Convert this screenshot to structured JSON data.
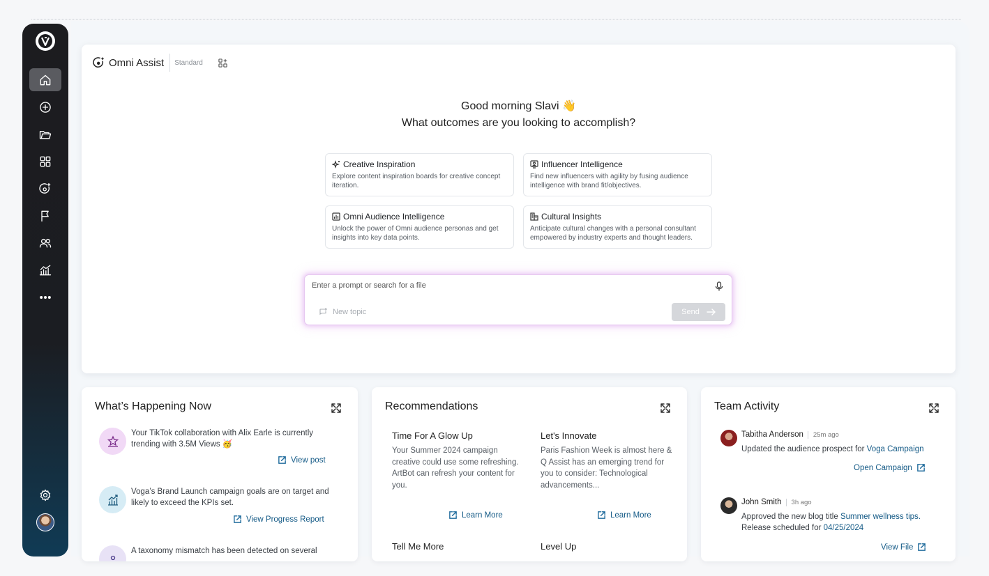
{
  "sidebar": {
    "items": [
      {
        "name": "home-icon",
        "active": true
      },
      {
        "name": "add-circle-icon"
      },
      {
        "name": "folder-icon"
      },
      {
        "name": "apps-grid-icon"
      },
      {
        "name": "assist-icon"
      },
      {
        "name": "flag-icon"
      },
      {
        "name": "users-icon"
      },
      {
        "name": "analytics-icon"
      },
      {
        "name": "more-icon"
      }
    ],
    "bottom": [
      "gear-icon",
      "avatar"
    ]
  },
  "assist": {
    "brand": "Omni Assist",
    "tier": "Standard",
    "greeting": "Good morning Slavi 👋",
    "question": "What outcomes are you looking to accomplish?",
    "options": [
      {
        "icon": "sparkle-icon",
        "title": "Creative Inspiration",
        "desc": "Explore content inspiration boards for creative concept iteration."
      },
      {
        "icon": "influencer-icon",
        "title": "Influencer Intelligence",
        "desc": "Find new influencers with agility by fusing audience intelligence with brand fit/objectives."
      },
      {
        "icon": "chart-icon",
        "title": "Omni Audience Intelligence",
        "desc": "Unlock the power of Omni audience personas and get insights into key data points."
      },
      {
        "icon": "buildings-icon",
        "title": "Cultural Insights",
        "desc": "Anticipate cultural changes with a personal consultant empowered by industry experts and thought leaders."
      }
    ],
    "prompt_placeholder": "Enter a prompt or search for a file",
    "new_topic": "New topic",
    "send": "Send"
  },
  "happening": {
    "title": "What’s Happening Now",
    "items": [
      {
        "icon": "stars-icon",
        "color": "#f1d9f6",
        "text": "Your TikTok collaboration with Alix Earle is currently trending with 3.5M Views 🥳",
        "link": "View post"
      },
      {
        "icon": "growth-chart-icon",
        "color": "#d6ecf5",
        "text": "Voga’s Brand Launch campaign goals are on target and likely to exceed the KPIs set.",
        "link": "View Progress Report"
      },
      {
        "icon": "taxonomy-icon",
        "color": "#e8e2f6",
        "text": "A taxonomy mismatch has been detected on several"
      }
    ]
  },
  "recommendations": {
    "title": "Recommendations",
    "items": [
      {
        "title": "Time For A Glow Up",
        "desc": "Your Summer 2024 campaign creative could use some refreshing. ArtBot can refresh your content for you.",
        "link": "Learn More"
      },
      {
        "title": "Let's Innovate",
        "desc": "Paris Fashion Week is almost here & Q Assist has an emerging trend for you to consider: Technological advancements...",
        "link": "Learn More"
      },
      {
        "title": "Tell Me More"
      },
      {
        "title": "Level Up"
      }
    ]
  },
  "team": {
    "title": "Team Activity",
    "items": [
      {
        "name": "Tabitha Anderson",
        "ago": "25m ago",
        "text_pre": "Updated the audience prospect for ",
        "highlight": "Voga Campaign",
        "link": "Open Campaign"
      },
      {
        "name": "John Smith",
        "ago": "3h ago",
        "text_pre": "Approved the new blog title ",
        "highlight": "Summer wellness tips.",
        "text_mid": "Release scheduled for ",
        "highlight2": "04/25/2024",
        "link": "View File"
      }
    ]
  }
}
